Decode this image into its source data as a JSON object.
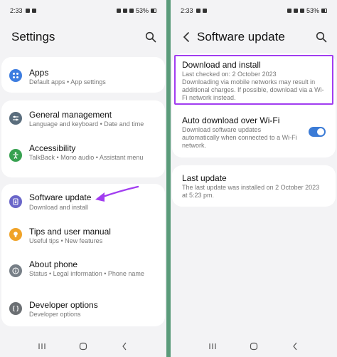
{
  "left": {
    "status": {
      "time": "2:33",
      "battery": "53%"
    },
    "title": "Settings",
    "items": [
      {
        "title": "Apps",
        "subtitle": "Default apps  •  App settings",
        "icon": "apps-icon",
        "color": "#3d7de0"
      },
      {
        "title": "General management",
        "subtitle": "Language and keyboard  •  Date and time",
        "icon": "sliders-icon",
        "color": "#5a6d7d"
      },
      {
        "title": "Accessibility",
        "subtitle": "TalkBack  •  Mono audio  •  Assistant menu",
        "icon": "accessibility-icon",
        "color": "#37a150"
      },
      {
        "title": "Software update",
        "subtitle": "Download and install",
        "icon": "software-update-icon",
        "color": "#6a66c9"
      },
      {
        "title": "Tips and user manual",
        "subtitle": "Useful tips  •  New features",
        "icon": "lightbulb-icon",
        "color": "#f0a328"
      },
      {
        "title": "About phone",
        "subtitle": "Status  •  Legal information  •  Phone name",
        "icon": "info-icon",
        "color": "#777f87"
      },
      {
        "title": "Developer options",
        "subtitle": "Developer options",
        "icon": "braces-icon",
        "color": "#6b6f73"
      }
    ]
  },
  "right": {
    "status": {
      "time": "2:33",
      "battery": "53%"
    },
    "title": "Software update",
    "download": {
      "title": "Download and install",
      "subtitle": "Last checked on: 2 October 2023\nDownloading via mobile networks may result in additional charges. If possible, download via a Wi-Fi network instead."
    },
    "auto": {
      "title": "Auto download over Wi-Fi",
      "subtitle": "Download software updates automatically when connected to a Wi-Fi network.",
      "enabled": true
    },
    "last": {
      "title": "Last update",
      "subtitle": "The last update was installed on 2 October 2023 at 5:23 pm."
    }
  },
  "colors": {
    "highlight": "#a13df0",
    "arrow": "#a13df0",
    "toggle": "#3b7bd6"
  }
}
